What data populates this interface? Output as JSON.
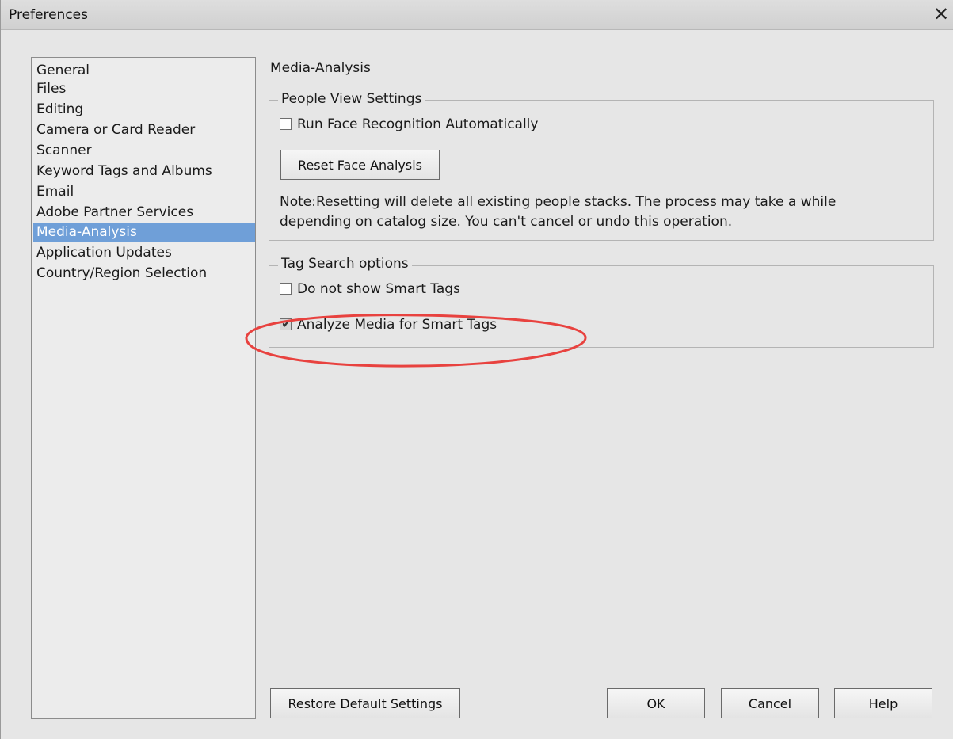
{
  "window": {
    "title": "Preferences"
  },
  "sidebar": {
    "items": [
      {
        "label": "General",
        "selected": false
      },
      {
        "label": "Files",
        "selected": false
      },
      {
        "label": "Editing",
        "selected": false
      },
      {
        "label": "Camera or Card Reader",
        "selected": false
      },
      {
        "label": "Scanner",
        "selected": false
      },
      {
        "label": "Keyword Tags and Albums",
        "selected": false
      },
      {
        "label": "Email",
        "selected": false
      },
      {
        "label": "Adobe Partner Services",
        "selected": false
      },
      {
        "label": "Media-Analysis",
        "selected": true
      },
      {
        "label": "Application Updates",
        "selected": false
      },
      {
        "label": "Country/Region Selection",
        "selected": false
      }
    ]
  },
  "panel": {
    "title": "Media-Analysis",
    "people_view": {
      "legend": "People View Settings",
      "face_recognition": {
        "label": "Run Face Recognition Automatically",
        "checked": false
      },
      "reset_button": "Reset Face Analysis",
      "note_line1": "Note:Resetting will delete all existing people stacks. The process may take a while",
      "note_line2": "depending on catalog size. You can't cancel or undo this operation."
    },
    "tag_search": {
      "legend": "Tag Search options",
      "hide_smart_tags": {
        "label": "Do not show Smart Tags",
        "checked": false
      },
      "analyze_media": {
        "label": "Analyze Media for Smart Tags",
        "checked": true
      }
    }
  },
  "footer": {
    "restore_button": "Restore Default Settings",
    "ok_button": "OK",
    "cancel_button": "Cancel",
    "help_button": "Help"
  },
  "icons": {
    "close": "close-icon",
    "checkmark": "checkmark-icon"
  },
  "colors": {
    "selection": "#6f9fd8",
    "annotation": "#e8423f",
    "background": "#e6e6e6"
  }
}
